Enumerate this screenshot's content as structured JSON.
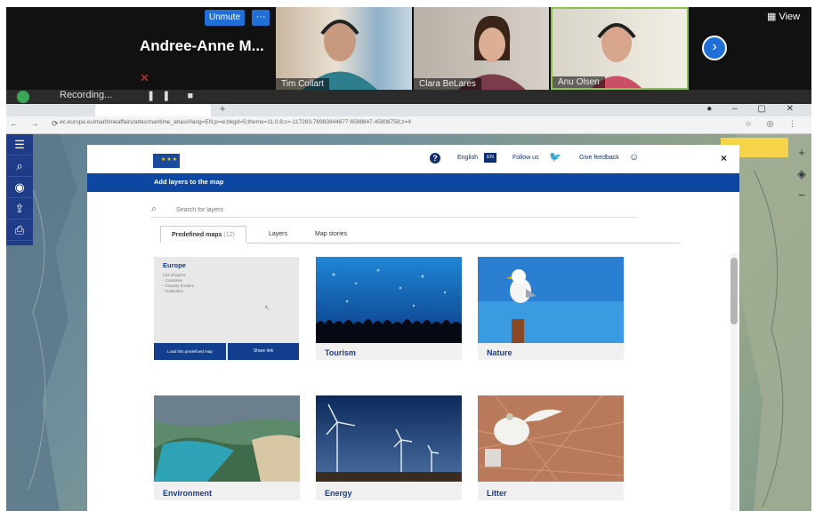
{
  "zoom": {
    "presenter_name": "Andree-Anne M...",
    "unmute_label": "Unmute",
    "more_label": "···",
    "view_label": "View",
    "participants": [
      {
        "name": "Tim Collart"
      },
      {
        "name": "Clara BeLares"
      },
      {
        "name": "Anu Olsen"
      }
    ],
    "recording_label": "Recording..."
  },
  "browser": {
    "tab_title": "",
    "url": "ec.europa.eu/maritimeaffairs/atlas/maritime_atlas/#lang=EN;p=w;bkgd=5;theme=11:0.8;c=-117283.76983844677:6588847.45808758;z=4"
  },
  "map_note": "",
  "modal": {
    "header": {
      "language": "English",
      "language_code": "EN",
      "follow_us": "Follow us",
      "give_feedback": "Give feedback",
      "close": "×"
    },
    "title": "Add layers to the map",
    "search_placeholder": "Search for layers",
    "tabs": [
      {
        "label": "Predefined maps",
        "count": "(12)"
      },
      {
        "label": "Layers"
      },
      {
        "label": "Map stories"
      }
    ],
    "europe_card": {
      "title": "Europe",
      "lines": [
        "List of layers:",
        "- Countries",
        "- Country borders",
        "- Graticules"
      ],
      "load_button": "Load this predefined map",
      "share_button": "Share link"
    },
    "cards": [
      {
        "caption": "Tourism"
      },
      {
        "caption": "Nature"
      },
      {
        "caption": "Environment"
      },
      {
        "caption": "Energy"
      },
      {
        "caption": "Litter"
      }
    ]
  },
  "colors": {
    "eu_blue": "#0e47a1",
    "zoom_blue": "#1f6fd6",
    "map_toolbar": "#1f3c88"
  }
}
